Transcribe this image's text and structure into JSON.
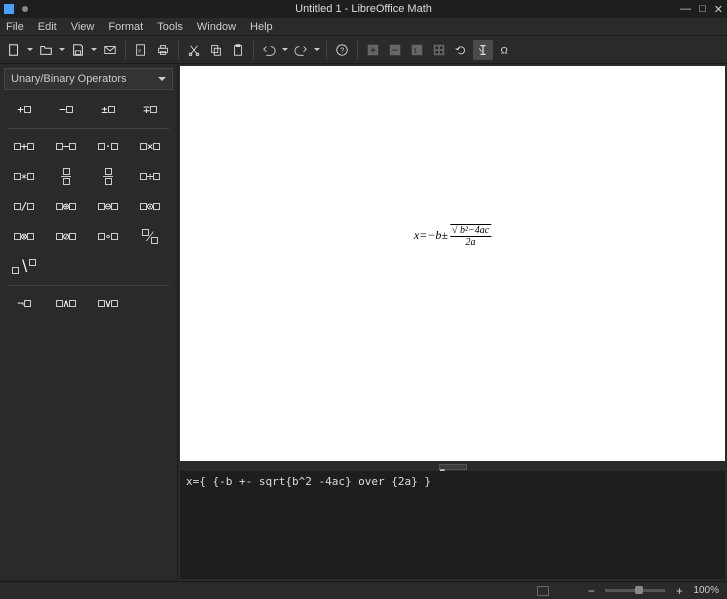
{
  "window": {
    "title": "Untitled 1 - LibreOffice Math"
  },
  "menu": {
    "file": "File",
    "edit": "Edit",
    "view": "View",
    "format": "Format",
    "tools": "Tools",
    "window": "Window",
    "help": "Help"
  },
  "sidebar": {
    "category": "Unary/Binary Operators"
  },
  "palette": {
    "r1": {
      "a": "+▫",
      "b": "−▫",
      "c": "±▫",
      "d": "∓▫"
    },
    "r2": {
      "a": "▫+▫",
      "b": "▫−▫",
      "c": "▫·▫",
      "d": "▫×▫"
    },
    "r3": {
      "a": "▫∗▫",
      "b": "▫/▫",
      "c": "▫/▫",
      "d": "▫÷▫"
    },
    "r4": {
      "a": "▫/▫",
      "b": "▫⊕▫",
      "c": "▫⊖▫",
      "d": "▫⊙▫"
    },
    "r5": {
      "a": "▫⊗▫",
      "b": "▫⊘▫",
      "c": "▫∘▫",
      "d": "▫⁄▫"
    },
    "r6": {
      "a": "▫∖▫"
    },
    "r7": {
      "a": "¬▫",
      "b": "▫∧▫",
      "c": "▫∨▫"
    }
  },
  "formula": {
    "lhs": "x=−b±",
    "num": "√ b²−4ac",
    "den": "2a"
  },
  "editor": {
    "text": "x={ {-b +- sqrt{b^2 -4ac} over {2a} }"
  },
  "status": {
    "zoom": "100%"
  }
}
